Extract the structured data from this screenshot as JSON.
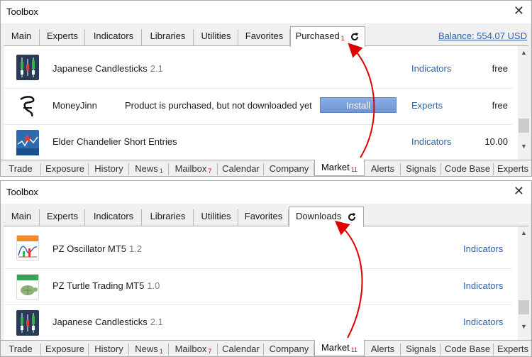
{
  "colors": {
    "link": "#3163a6",
    "badge_red": "#e00000",
    "arrow_red": "#e00000",
    "install_btn": "#7ba1db"
  },
  "top_panel": {
    "title": "Toolbox",
    "close_icon": "close-icon",
    "tabs": [
      {
        "label": "Main"
      },
      {
        "label": "Experts"
      },
      {
        "label": "Indicators"
      },
      {
        "label": "Libraries"
      },
      {
        "label": "Utilities"
      },
      {
        "label": "Favorites"
      },
      {
        "label": "Purchased",
        "badge": "1",
        "active": true
      }
    ],
    "balance": "Balance: 554.07 USD",
    "rows": [
      {
        "icon": "candlesticks-icon",
        "name": "Japanese Candlesticks",
        "version": "2.1",
        "status": "",
        "button": "",
        "category": "Indicators",
        "price": "free"
      },
      {
        "icon": "moneyjinn-logo-icon",
        "name": "MoneyJinn",
        "version": "",
        "status": "Product is purchased, but not downloaded yet",
        "button": "Install",
        "category": "Experts",
        "price": "free"
      },
      {
        "icon": "elder-chandelier-icon",
        "name": "Elder Chandelier Short Entries",
        "version": "",
        "status": "",
        "button": "",
        "category": "Indicators",
        "price": "10.00"
      }
    ],
    "bottom_tabs": [
      {
        "label": "Trade"
      },
      {
        "label": "Exposure"
      },
      {
        "label": "History"
      },
      {
        "label": "News",
        "badge": "1"
      },
      {
        "label": "Mailbox",
        "badge": "7"
      },
      {
        "label": "Calendar"
      },
      {
        "label": "Company"
      },
      {
        "label": "Market",
        "badge": "11",
        "active": true
      },
      {
        "label": "Alerts"
      },
      {
        "label": "Signals"
      },
      {
        "label": "Code Base"
      },
      {
        "label": "Experts"
      }
    ]
  },
  "bottom_panel": {
    "title": "Toolbox",
    "close_icon": "close-icon",
    "tabs": [
      {
        "label": "Main"
      },
      {
        "label": "Experts"
      },
      {
        "label": "Indicators"
      },
      {
        "label": "Libraries"
      },
      {
        "label": "Utilities"
      },
      {
        "label": "Favorites"
      },
      {
        "label": "Downloads",
        "active": true
      }
    ],
    "rows": [
      {
        "icon": "pz-oscillator-icon",
        "name": "PZ Oscillator MT5",
        "version": "1.2",
        "category": "Indicators"
      },
      {
        "icon": "pz-turtle-icon",
        "name": "PZ Turtle Trading MT5",
        "version": "1.0",
        "category": "Indicators"
      },
      {
        "icon": "candlesticks-icon",
        "name": "Japanese Candlesticks",
        "version": "2.1",
        "category": "Indicators"
      }
    ],
    "bottom_tabs": [
      {
        "label": "Trade"
      },
      {
        "label": "Exposure"
      },
      {
        "label": "History"
      },
      {
        "label": "News",
        "badge": "1"
      },
      {
        "label": "Mailbox",
        "badge": "7"
      },
      {
        "label": "Calendar"
      },
      {
        "label": "Company"
      },
      {
        "label": "Market",
        "badge": "11",
        "active": true
      },
      {
        "label": "Alerts"
      },
      {
        "label": "Signals"
      },
      {
        "label": "Code Base"
      },
      {
        "label": "Experts"
      }
    ]
  }
}
